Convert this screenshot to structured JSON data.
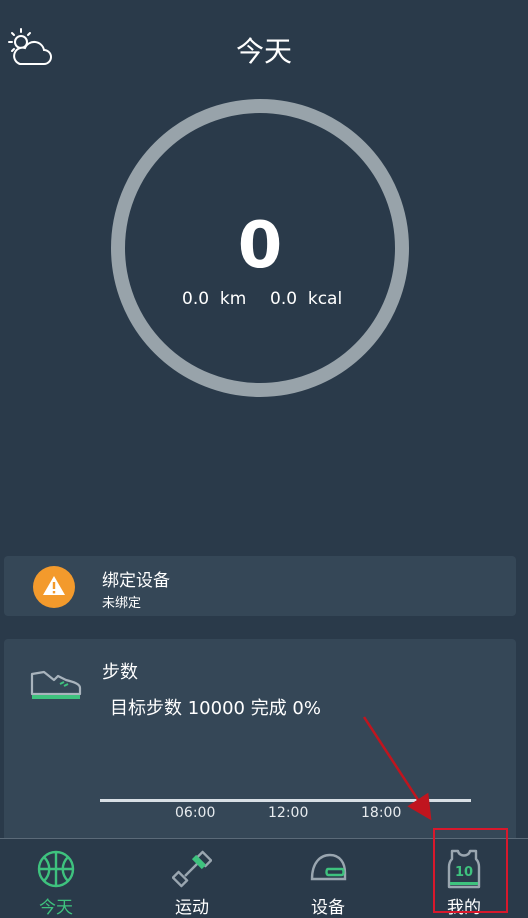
{
  "header": {
    "title": "今天",
    "weather_icon": "weather-partly-cloudy-icon"
  },
  "summary": {
    "steps": "0",
    "distance": "0.0  km",
    "calories": "0.0  kcal"
  },
  "bind_card": {
    "title": "绑定设备",
    "status": "未绑定",
    "icon": "warning-icon"
  },
  "steps_card": {
    "title": "步数",
    "goal_text": "目标步数 10000 完成 0%",
    "icon": "shoe-icon",
    "ticks": [
      "06:00",
      "12:00",
      "18:00"
    ]
  },
  "nav": {
    "items": [
      {
        "label": "今天",
        "icon": "basketball-icon",
        "active": true
      },
      {
        "label": "运动",
        "icon": "dumbbell-icon",
        "active": false
      },
      {
        "label": "设备",
        "icon": "helmet-icon",
        "active": false
      },
      {
        "label": "我的",
        "icon": "jersey-icon",
        "jersey_number": "10",
        "active": false
      }
    ]
  },
  "colors": {
    "background": "#2a3a4a",
    "card": "#354757",
    "accent": "#3ec27e",
    "warning": "#f39a2c",
    "annotation": "#c0151e"
  }
}
